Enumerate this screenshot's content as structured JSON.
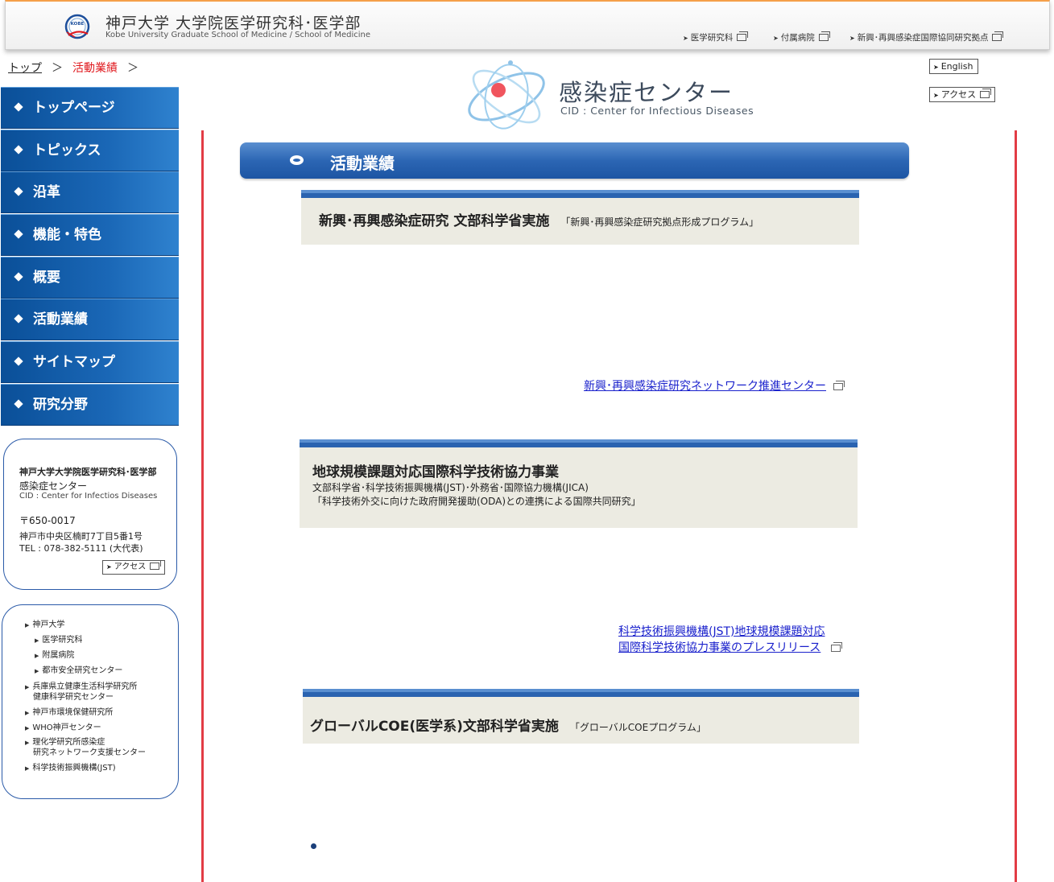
{
  "header": {
    "univ_title_jp": "神戸大学 大学院医学研究科･医学部",
    "univ_title_en": "Kobe University Graduate School of Medicine / School of Medicine",
    "logo_text": "KOBE",
    "links": [
      {
        "label": "医学研究科"
      },
      {
        "label": "付属病院"
      },
      {
        "label": "新興･再興感染症国際協同研究拠点"
      }
    ]
  },
  "breadcrumb": {
    "top": "トップ",
    "separator": "＞",
    "current": "活動業績"
  },
  "cid": {
    "title": "感染症センター",
    "subtitle": "CID : Center for Infectious Diseases"
  },
  "buttons": {
    "english": "English",
    "access": "アクセス"
  },
  "sidebar": {
    "items": [
      {
        "label": "トップページ"
      },
      {
        "label": "トピックス"
      },
      {
        "label": "沿革"
      },
      {
        "label": "機能・特色"
      },
      {
        "label": "概要"
      },
      {
        "label": "活動業績"
      },
      {
        "label": "サイトマップ"
      },
      {
        "label": "研究分野"
      }
    ]
  },
  "address": {
    "org": "神戸大学大学院医学研究科･医学部",
    "center": "感染症センター",
    "center_en": "CID : Center for Infectios Diseases",
    "zip": "〒650-0017",
    "street": "神戸市中央区楠町7丁目5番1号",
    "tel": "TEL : 078-382-5111 (大代表)",
    "access": "アクセス"
  },
  "links_box": {
    "items": [
      {
        "label": "神戸大学"
      },
      {
        "label": "医学研究科"
      },
      {
        "label": "附属病院"
      },
      {
        "label": "都市安全研究センター"
      },
      {
        "label": "兵庫県立健康生活科学研究所"
      },
      {
        "label": "健康科学研究センター"
      },
      {
        "label": "神戸市環境保健研究所"
      },
      {
        "label": "WHO神戸センター"
      },
      {
        "label": "理化学研究所感染症"
      },
      {
        "label": "研究ネットワーク支援センター"
      },
      {
        "label": "科学技術振興機構(JST)"
      }
    ]
  },
  "section": {
    "title": "活動業績"
  },
  "panels": [
    {
      "title": "新興･再興感染症研究 文部科学省実施",
      "note": "「新興･再興感染症研究拠点形成プログラム」",
      "link": "新興･再興感染症研究ネットワーク推進センター"
    },
    {
      "title": "地球規模課題対応国際科学技術協力事業",
      "line1": "文部科学省･科学技術振興機構(JST)･外務省･国際協力機構(JICA)",
      "line2": "「科学技術外交に向けた政府開発援助(ODA)との連携による国際共同研究」",
      "link_line1": "科学技術振興機構(JST)地球規模課題対応",
      "link_line2": "国際科学技術協力事業のプレスリリース"
    },
    {
      "title": "グローバルCOE(医学系)文部科学省実施",
      "note": "「グローバルCOEプログラム」"
    }
  ],
  "colors": {
    "nav_blue": "#1a67b6",
    "accent_red": "#e0191e",
    "link_blue": "#1a21cc",
    "panel_bg": "#ecebe2"
  }
}
